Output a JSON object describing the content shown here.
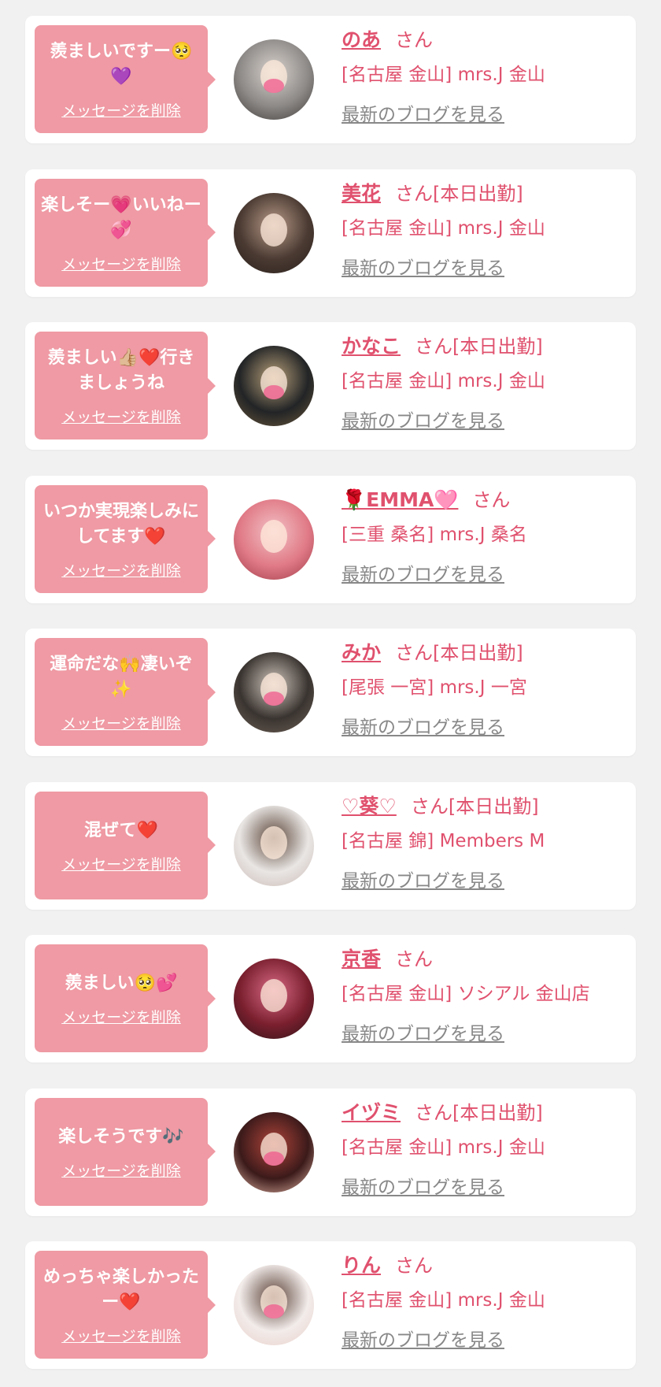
{
  "ui": {
    "delete_label": "メッセージを削除",
    "blog_label": "最新のブログを見る",
    "accent_color": "#e0516e",
    "bubble_color": "#ef9aa4",
    "background_color": "#f1f1f1"
  },
  "entries": [
    {
      "message": "羨ましいですー🥺💜",
      "name": "のあ",
      "suffix": "さん",
      "shop": "[名古屋 金山] mrs.J 金山",
      "avatar": {
        "colors": [
          "#8d8a88",
          "#d9d2cc",
          "#3c3836"
        ],
        "blush": true
      }
    },
    {
      "message": "楽しそー💗いいねー💞",
      "name": "美花",
      "suffix": "さん[本日出勤]",
      "shop": "[名古屋 金山] mrs.J 金山",
      "avatar": {
        "colors": [
          "#4a3a32",
          "#b89a88",
          "#2a201c"
        ],
        "blush": false
      }
    },
    {
      "message": "羨ましい👍🏼❤️行きましょうね",
      "name": "かなこ",
      "suffix": "さん[本日出勤]",
      "shop": "[名古屋 金山] mrs.J 金山",
      "avatar": {
        "colors": [
          "#222426",
          "#b8a07a",
          "#6e5a3c"
        ],
        "blush": true
      }
    },
    {
      "message": "いつか実現楽しみにしてます❤️",
      "name": "🌹EMMA🩷",
      "suffix": "さん",
      "shop": "[三重 桑名] mrs.J 桑名",
      "avatar": {
        "colors": [
          "#e07a86",
          "#f3c1c6",
          "#9e3a46"
        ],
        "blush": false
      }
    },
    {
      "message": "運命だな🙌凄いぞ✨",
      "name": "みか",
      "suffix": "さん[本日出勤]",
      "shop": "[尾張 一宮] mrs.J 一宮",
      "avatar": {
        "colors": [
          "#3a3430",
          "#cfc6bd",
          "#6f6258"
        ],
        "blush": true
      }
    },
    {
      "message": "混ぜて❤️",
      "name": "♡葵♡",
      "suffix": "さん[本日出勤]",
      "shop": "[名古屋 錦] Members M",
      "avatar": {
        "colors": [
          "#e9e6e4",
          "#5b4538",
          "#c9b8b2"
        ],
        "blush": false
      }
    },
    {
      "message": "羨ましい🥺💕",
      "name": "京香",
      "suffix": "さん",
      "shop": "[名古屋 金山] ソシアル 金山店",
      "avatar": {
        "colors": [
          "#7a1f2e",
          "#d86a86",
          "#2b1418"
        ],
        "blush": false
      }
    },
    {
      "message": "楽しそうです🎶",
      "name": "イヅミ",
      "suffix": "さん[本日出勤]",
      "shop": "[名古屋 金山] mrs.J 金山",
      "avatar": {
        "colors": [
          "#3b1a1a",
          "#b0443a",
          "#e8b9a8"
        ],
        "blush": true
      }
    },
    {
      "message": "めっちゃ楽しかったー❤️",
      "name": "りん",
      "suffix": "さん",
      "shop": "[名古屋 金山] mrs.J 金山",
      "avatar": {
        "colors": [
          "#f2ecea",
          "#5a4036",
          "#e9cfc8"
        ],
        "blush": true
      }
    }
  ]
}
